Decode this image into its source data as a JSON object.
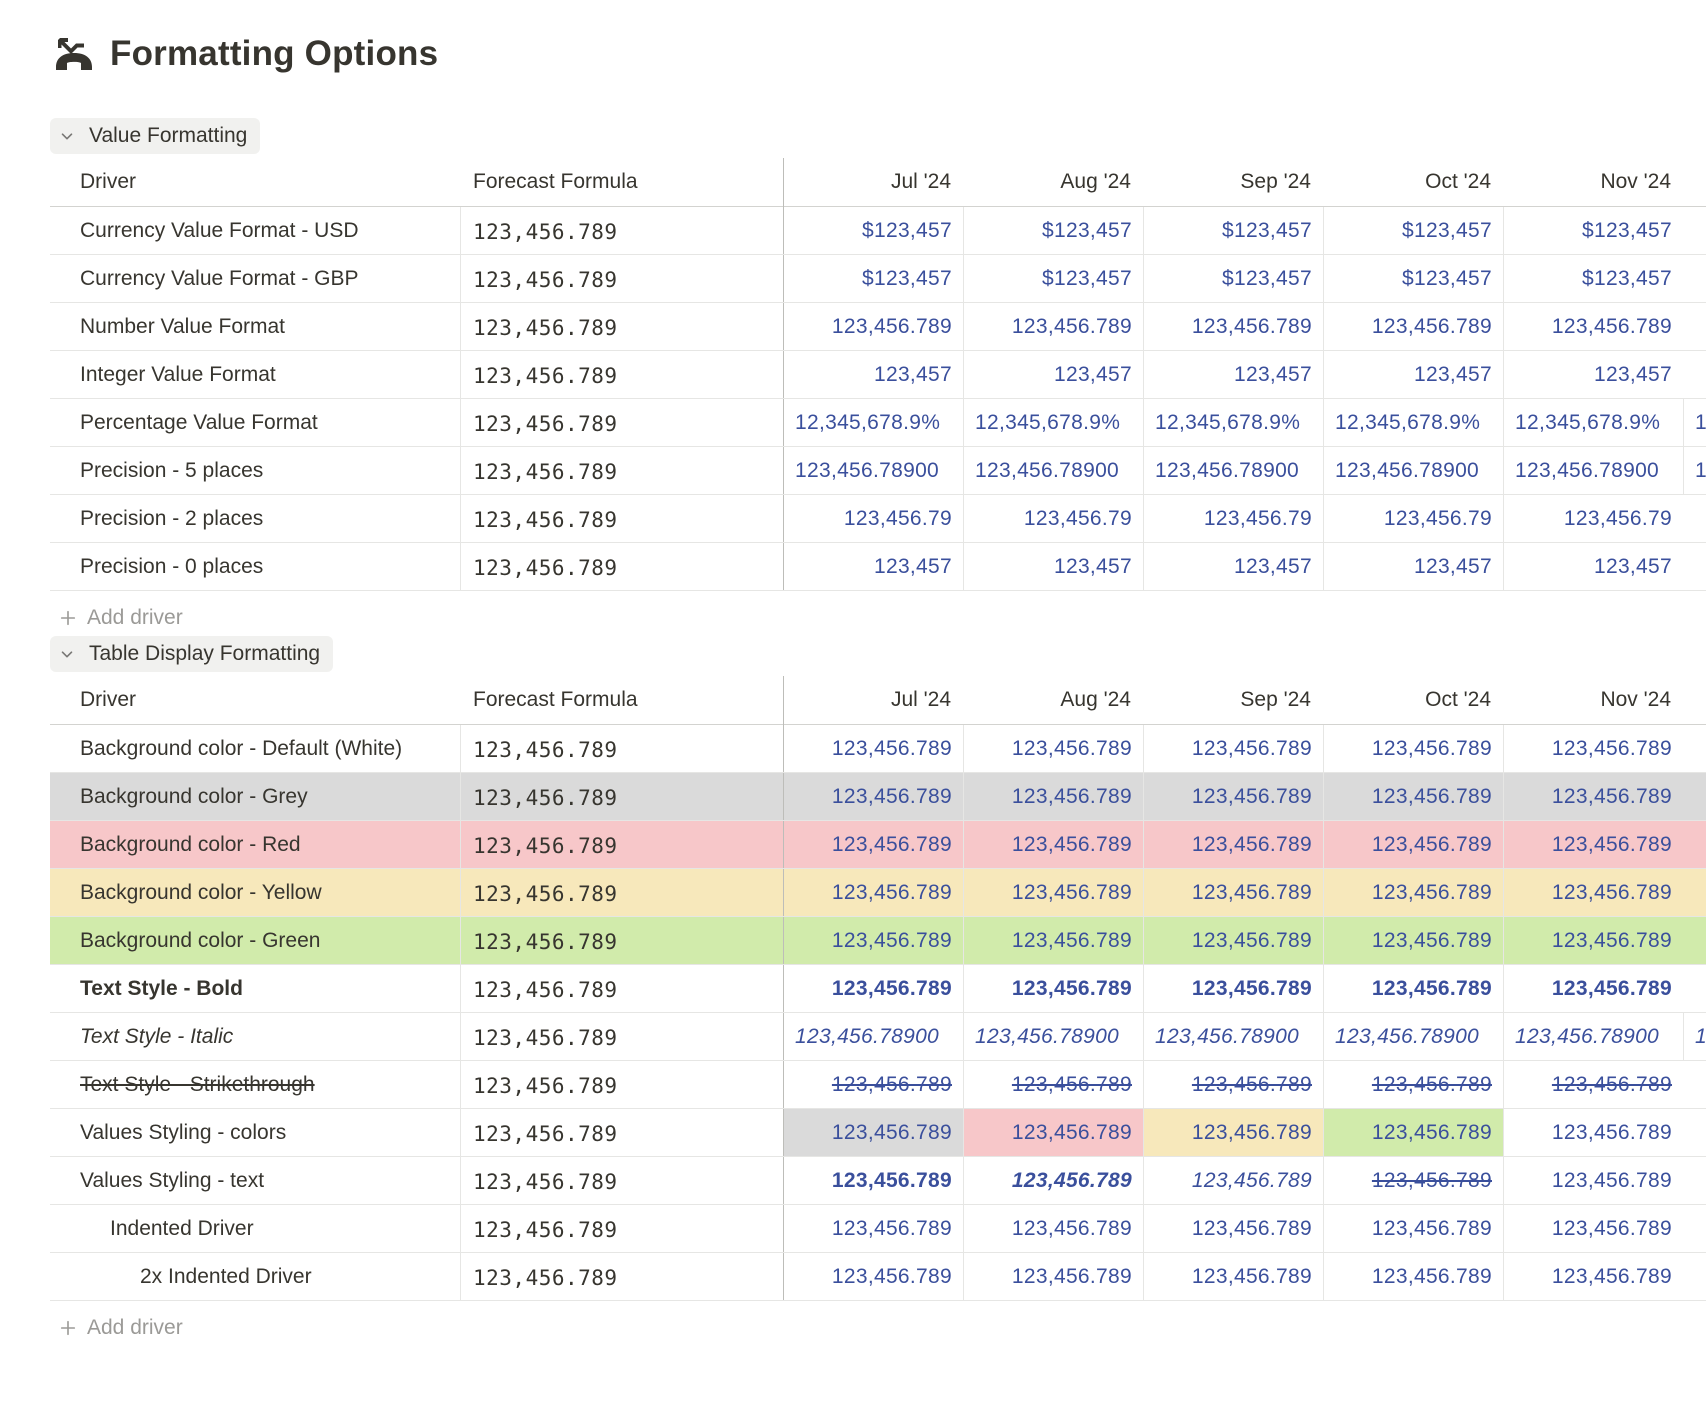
{
  "page": {
    "title": "Formatting Options",
    "icon": "phone-hangup-icon"
  },
  "colors": {
    "value_text": "#3a4f9c",
    "grey_bg": "#dadada",
    "red_bg": "#f7c7c9",
    "yellow_bg": "#f7e8bb",
    "green_bg": "#d1ebab",
    "group_pill_bg": "#f1f1ef"
  },
  "columns": {
    "driver": "Driver",
    "formula": "Forecast Formula",
    "months": [
      "Jul '24",
      "Aug '24",
      "Sep '24",
      "Oct '24",
      "Nov '24"
    ]
  },
  "sections": [
    {
      "label": "Value Formatting",
      "add_label": "Add driver",
      "rows": [
        {
          "name": "Currency Value Format - USD",
          "formula": "123,456.789",
          "values": [
            "$123,457",
            "$123,457",
            "$123,457",
            "$123,457",
            "$123,457"
          ]
        },
        {
          "name": "Currency Value Format - GBP",
          "formula": "123,456.789",
          "values": [
            "$123,457",
            "$123,457",
            "$123,457",
            "$123,457",
            "$123,457"
          ]
        },
        {
          "name": "Number Value Format",
          "formula": "123,456.789",
          "values": [
            "123,456.789",
            "123,456.789",
            "123,456.789",
            "123,456.789",
            "123,456.789"
          ]
        },
        {
          "name": "Integer Value Format",
          "formula": "123,456.789",
          "values": [
            "123,457",
            "123,457",
            "123,457",
            "123,457",
            "123,457"
          ]
        },
        {
          "name": "Percentage Value Format",
          "formula": "123,456.789",
          "clip": true,
          "values": [
            "12,345,678.9%",
            "12,345,678.9%",
            "12,345,678.9%",
            "12,345,678.9%",
            "12,345,678.9%",
            "1"
          ]
        },
        {
          "name": "Precision - 5 places",
          "formula": "123,456.789",
          "clip": true,
          "values": [
            "123,456.78900",
            "123,456.78900",
            "123,456.78900",
            "123,456.78900",
            "123,456.78900",
            "1"
          ]
        },
        {
          "name": "Precision - 2 places",
          "formula": "123,456.789",
          "values": [
            "123,456.79",
            "123,456.79",
            "123,456.79",
            "123,456.79",
            "123,456.79"
          ]
        },
        {
          "name": "Precision - 0 places",
          "formula": "123,456.789",
          "values": [
            "123,457",
            "123,457",
            "123,457",
            "123,457",
            "123,457"
          ]
        }
      ]
    },
    {
      "label": "Table Display Formatting",
      "add_label": "Add driver",
      "rows": [
        {
          "name": "Background color - Default (White)",
          "formula": "123,456.789",
          "values": [
            "123,456.789",
            "123,456.789",
            "123,456.789",
            "123,456.789",
            "123,456.789"
          ]
        },
        {
          "name": "Background color - Grey",
          "formula": "123,456.789",
          "bg": "grey_bg",
          "values": [
            "123,456.789",
            "123,456.789",
            "123,456.789",
            "123,456.789",
            "123,456.789"
          ]
        },
        {
          "name": "Background color - Red",
          "formula": "123,456.789",
          "bg": "red_bg",
          "values": [
            "123,456.789",
            "123,456.789",
            "123,456.789",
            "123,456.789",
            "123,456.789"
          ]
        },
        {
          "name": "Background color - Yellow",
          "formula": "123,456.789",
          "bg": "yellow_bg",
          "values": [
            "123,456.789",
            "123,456.789",
            "123,456.789",
            "123,456.789",
            "123,456.789"
          ]
        },
        {
          "name": "Background color - Green",
          "formula": "123,456.789",
          "bg": "green_bg",
          "values": [
            "123,456.789",
            "123,456.789",
            "123,456.789",
            "123,456.789",
            "123,456.789"
          ]
        },
        {
          "name": "Text Style - Bold",
          "formula": "123,456.789",
          "style": "bold",
          "values": [
            "123,456.789",
            "123,456.789",
            "123,456.789",
            "123,456.789",
            "123,456.789"
          ]
        },
        {
          "name": "Text Style - Italic",
          "formula": "123,456.789",
          "style": "italic",
          "clip": true,
          "values": [
            "123,456.78900",
            "123,456.78900",
            "123,456.78900",
            "123,456.78900",
            "123,456.78900",
            "1"
          ]
        },
        {
          "name": "Text Style - Strikethrough",
          "formula": "123,456.789",
          "style": "strike",
          "values": [
            "123,456.789",
            "123,456.789",
            "123,456.789",
            "123,456.789",
            "123,456.789"
          ]
        },
        {
          "name": "Values Styling - colors",
          "formula": "123,456.789",
          "values": [
            "123,456.789",
            "123,456.789",
            "123,456.789",
            "123,456.789",
            "123,456.789"
          ],
          "cell_bg": [
            "grey_bg",
            "red_bg",
            "yellow_bg",
            "green_bg",
            null
          ]
        },
        {
          "name": "Values Styling - text",
          "formula": "123,456.789",
          "values": [
            "123,456.789",
            "123,456.789",
            "123,456.789",
            "123,456.789",
            "123,456.789"
          ],
          "cell_style": [
            "bold",
            "bold italic",
            "italic",
            "strike",
            null
          ]
        },
        {
          "name": "Indented Driver",
          "formula": "123,456.789",
          "indent": 1,
          "values": [
            "123,456.789",
            "123,456.789",
            "123,456.789",
            "123,456.789",
            "123,456.789"
          ]
        },
        {
          "name": "2x Indented Driver",
          "formula": "123,456.789",
          "indent": 2,
          "values": [
            "123,456.789",
            "123,456.789",
            "123,456.789",
            "123,456.789",
            "123,456.789"
          ]
        }
      ]
    }
  ]
}
